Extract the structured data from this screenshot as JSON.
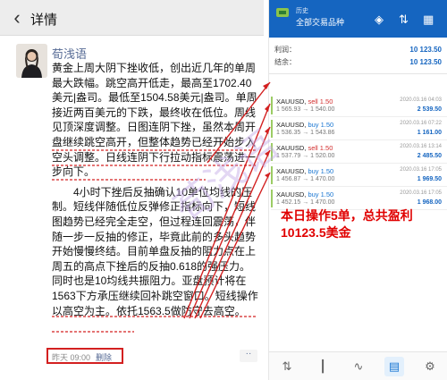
{
  "moment": {
    "header_title": "详情",
    "author": "荀浅语",
    "paragraph1": "黄金上周大阴下挫收低，创出近几年的单周最大跌幅。跳空高开低走，最高至1702.40美元|盎司。最低至1504.58美元|盎司。单周接近两百美元的下跌，最终收在低位。周线见顶深度调整。日图连阴下挫，虽然本周开盘继续跳空高开，但整体趋势已经开始步入空头调整。日线连阴下行拉动指标震荡进一步向下。",
    "paragraph2": "4小时下挫后反抽确认10单位均线的压制。短线伴随低位反弹修正指标向下，短线图趋势已经完全走空，但过程连回震荡，伴随一步一反抽的修正，毕竟此前的多头趋势开始慢慢终结。目前单盘反抽的阻力点在上周五的高点下挫后的反抽0.618的强压力。同时也是10均线共振阻力。亚盘预计将在1563下方承压继续回补跳空窗口。短线操作以高空为主。依托1563.5做防守去高空。",
    "time": "昨天 09:00",
    "delete_label": "删除",
    "more_label": "··"
  },
  "annotation": {
    "text": "本日操作5单，总共盈利10123.5美金",
    "color": "#e00000",
    "watermark": "荀浅语"
  },
  "trading": {
    "header_small": "历史",
    "header_title": "全部交易品种",
    "profit_label": "利润：",
    "profit_value": "10 123.50",
    "balance_label": "结余：",
    "balance_value": "10 123.50",
    "trades": [
      {
        "symbol": "XAUUSD,",
        "side": "sell 1.50",
        "prices": "1 565.93 → 1 540.00",
        "time": "2020.03.16 04:03",
        "profit": "2 539.50"
      },
      {
        "symbol": "XAUUSD,",
        "side": "buy 1.50",
        "prices": "1 536.35 → 1 543.86",
        "time": "2020.03.16 07:22",
        "profit": "1 161.00"
      },
      {
        "symbol": "XAUUSD,",
        "side": "sell 1.50",
        "prices": "1 537.79 → 1 520.00",
        "time": "2020.03.16 13:14",
        "profit": "2 485.50"
      },
      {
        "symbol": "XAUUSD,",
        "side": "buy 1.50",
        "prices": "1 456.87 → 1 470.00",
        "time": "2020.03.16 17:05",
        "profit": "1 969.50"
      },
      {
        "symbol": "XAUUSD,",
        "side": "buy 1.50",
        "prices": "1 452.15 → 1 470.00",
        "time": "2020.03.16 17:05",
        "profit": "1 968.00"
      }
    ],
    "tabs": [
      "quotes-icon",
      "chart-icon",
      "trade-icon",
      "history-icon",
      "settings-icon"
    ]
  }
}
